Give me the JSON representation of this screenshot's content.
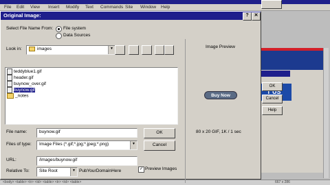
{
  "background_app": {
    "menu": [
      "File",
      "Edit",
      "View",
      "Insert",
      "Modify",
      "Text",
      "Commands",
      "Site",
      "Window",
      "Help"
    ],
    "status_text": "<body> <table> <tr> <td> <table> <tr> <td> <table>",
    "status_right": "667 x 286"
  },
  "dialog": {
    "title": "Original Image:",
    "help_btn": "?",
    "close_btn": "✕",
    "select_from_label": "Select File Name From:",
    "radio_file_system": "File system",
    "radio_data_sources": "Data Sources",
    "look_in_label": "Look in:",
    "look_in_value": "images",
    "files": [
      {
        "name": "teddyblue1.gif",
        "type": "file"
      },
      {
        "name": "header.gif",
        "type": "file"
      },
      {
        "name": "buynow_over.gif",
        "type": "file"
      },
      {
        "name": "buynow.gif",
        "type": "file",
        "selected": true
      },
      {
        "name": "_notes",
        "type": "folder"
      }
    ],
    "file_name_label": "File name:",
    "file_name_value": "buynow.gif",
    "files_of_type_label": "Files of type:",
    "files_of_type_value": "Image Files (*.gif;*.jpg;*.jpeg;*.png)",
    "ok_label": "OK",
    "cancel_label": "Cancel",
    "url_label": "URL:",
    "url_value": "/images/buynow.gif",
    "relative_label": "Relative To:",
    "relative_value": "Site Root",
    "relative_path": "PubYourDomainHere",
    "image_preview_label": "Image Preview",
    "preview_button_text": "Buy Now",
    "image_info": "80 x 20 GIF, 1K / 1 sec",
    "preview_images_label": "Preview Images",
    "preview_images_checked": true
  },
  "side_dialog": {
    "ok": "OK",
    "cancel": "Cancel",
    "help": "Help",
    "web_text": "T US"
  },
  "colors": {
    "titlebar": "#1f1f8c",
    "dialog_bg": "#d4d0c8",
    "brand_red": "#d21f2a",
    "brand_blue": "#1c3a8f"
  }
}
